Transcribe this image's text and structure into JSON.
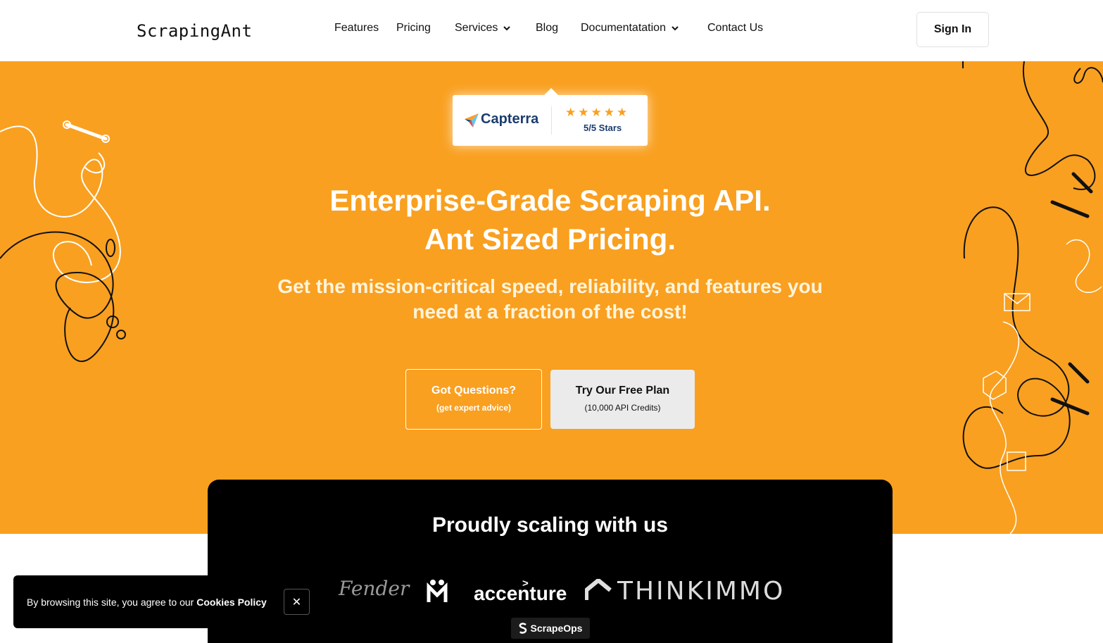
{
  "header": {
    "logo": "ScrapingAnt",
    "nav": [
      {
        "label": "Features",
        "has_dropdown": false
      },
      {
        "label": "Pricing",
        "has_dropdown": false
      },
      {
        "label": "Services",
        "has_dropdown": true
      },
      {
        "label": "Blog",
        "has_dropdown": false
      },
      {
        "label": "Documentatation",
        "has_dropdown": true
      },
      {
        "label": "Contact Us",
        "has_dropdown": false
      }
    ],
    "sign_in": "Sign In"
  },
  "hero": {
    "badge": {
      "brand": "Capterra",
      "stars": "★★★★★",
      "rating": "5/5 Stars"
    },
    "title_line1": "Enterprise-Grade Scraping API.",
    "title_line2": "Ant Sized Pricing.",
    "subtitle_line1": "Get the mission-critical speed, reliability, and features you",
    "subtitle_line2": "need at a fraction of the cost!",
    "btn_questions": {
      "label": "Got Questions?",
      "sub": "(get expert advice)"
    },
    "btn_free": {
      "label": "Try Our Free Plan",
      "sub": "(10,000 API Credits)"
    }
  },
  "clients": {
    "title": "Proudly scaling with us",
    "logos": [
      "Fender",
      "M",
      "accenture",
      "THINKIMMO",
      "ScrapeOps"
    ]
  },
  "cookie": {
    "text": "By browsing this site, you agree to our ",
    "link": "Cookies Policy",
    "close": "✕"
  },
  "colors": {
    "hero_bg": "#f9a020",
    "panel_bg": "#000000",
    "capterra_text": "#1b3d6e"
  }
}
